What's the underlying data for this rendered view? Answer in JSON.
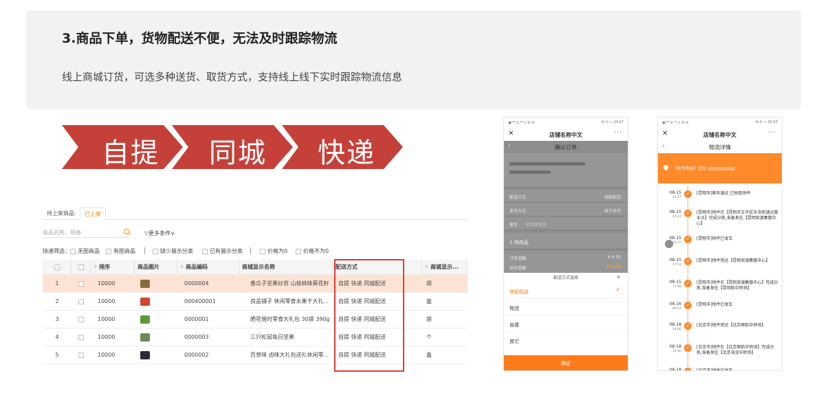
{
  "header": {
    "title": "3.商品下单，货物配送不便，无法及时跟踪物流",
    "description": "线上商城订货，可选多种送货、取货方式，支持线上线下实时跟踪物流信息"
  },
  "banner": {
    "items": [
      "自提",
      "同城",
      "快递"
    ],
    "color": "#c6403a"
  },
  "product_table": {
    "tabs": [
      "待上架商品",
      "已上架"
    ],
    "active_tab": "已上架",
    "search_placeholder": "商品名称、规格",
    "more_filter": "▽更多条件∨",
    "quick_filter_label": "快速筛选：",
    "quick_filters": [
      "无图商品",
      "有图商品",
      "缺少展示分类",
      "已有展示分类",
      "价格为0",
      "价格不为0"
    ],
    "columns": [
      "排序",
      "商品图片",
      "商品编码",
      "商城显示名称",
      "配送方式",
      "商城显示..."
    ],
    "rows": [
      {
        "index": "1",
        "sort": "10000",
        "code": "0000004",
        "name": "香瓜子坚果炒货 山核桃味葵花籽",
        "delivery": "自提 快递 同城配送",
        "unit": "袋",
        "thumb_color": "#8a6a3a"
      },
      {
        "index": "2",
        "sort": "10000",
        "code": "000400001",
        "name": "良品铺子 休闲零食水果干大礼...",
        "delivery": "自提 快递 同城配送",
        "unit": "盒",
        "thumb_color": "#d2482e"
      },
      {
        "index": "3",
        "sort": "10000",
        "code": "0000001",
        "name": "晒花借时零食大礼包 30袋 390g",
        "delivery": "自提 快递 同城配送",
        "unit": "袋",
        "thumb_color": "#5a9a3a"
      },
      {
        "index": "4",
        "sort": "10000",
        "code": "0000003",
        "name": "三只松鼠每日坚果",
        "delivery": "自提 快递 同城配送",
        "unit": "个",
        "thumb_color": "#6a8a5a"
      },
      {
        "index": "5",
        "sort": "10000",
        "code": "0000002",
        "name": "百草味 卤味大礼包送礼休闲零...",
        "delivery": "自提 快递 同城配送",
        "unit": "盒",
        "thumb_color": "#2a2a3a"
      }
    ]
  },
  "phone_order": {
    "status_left": "▣ᵃ⁴ᴳ.ıl ⁴ᴳ.ıl 令 ✉",
    "status_right": "✉ ✆ ▭ 23:47",
    "app_title": "店铺名称中文",
    "more": "···",
    "page_title": "确认订单",
    "rows": [
      {
        "label": "配送方式",
        "value": "商家配送"
      },
      {
        "label": "支付方式",
        "value": "线下支付"
      },
      {
        "label": "留言",
        "value": "给商家留言"
      }
    ],
    "goods_count": "2 种商品",
    "order_amount_label": "订单金额",
    "order_amount": "¥ 0.00",
    "shipping_label": "运付金额",
    "shipping_amount": "¥ 0.00",
    "sheet_title": "配送方式选择",
    "options": [
      "商家配送",
      "物流",
      "自提",
      "其它"
    ],
    "selected_option": "商家配送",
    "confirm": "确定"
  },
  "phone_logistics": {
    "status_left": "▣ᵃ⁴ᴳ.ıl ⁴ᴳ.ıl 令 ✉",
    "status_right": "✉ ✆ ▭ 20:53",
    "app_title": "店铺名称中文",
    "more": "···",
    "page_title": "物流详情",
    "address_prefix": "【收货地址】北京",
    "events": [
      {
        "date": "08-15",
        "time": "14:27",
        "text": "[昆明市]顺丰速运 已收取快件"
      },
      {
        "date": "08-15",
        "time": "14:27",
        "text": "[昆明市]快件在【昆明市五华区东寺街速运营业点】完成分拣,准备发往【昆明官渡集散中心】"
      },
      {
        "date": "08-15",
        "time": "16:37",
        "text": "[昆明市]快件已发车"
      },
      {
        "date": "08-15",
        "time": "17:51",
        "text": "[昆明市]快件到达【昆明官渡集散中心】"
      },
      {
        "date": "08-15",
        "time": "17:48",
        "text": "[昆明市]快件在【昆明官渡集散中心】完成分拣,准备发往【昆明航中转场】"
      },
      {
        "date": "08-16",
        "time": "06:14",
        "text": "[昆明市]快件已发车"
      },
      {
        "date": "08-18",
        "time": "14:00",
        "text": "[北京市]快件到达【北京顺航中转场】"
      },
      {
        "date": "08-18",
        "time": "14:00",
        "text": "[北京市]快件在【北京顺航中转场】完成分拣,准备发往【北京海淀中转场】"
      },
      {
        "date": "08-18",
        "time": "",
        "text": "[北京市]快件已发车"
      }
    ]
  }
}
